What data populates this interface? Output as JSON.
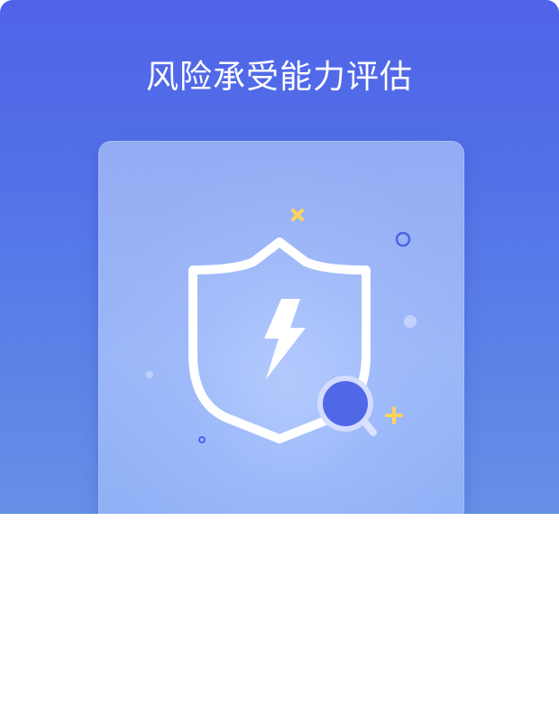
{
  "header": {
    "title": "风险承受能力评估"
  },
  "illustration": {
    "shield_icon": "shield-icon",
    "lightning_icon": "lightning-bolt-icon",
    "magnifier_icon": "magnifier-icon",
    "accent_color": "#5168e6",
    "decoration_yellow": "#ffd45a",
    "decoration_blue": "#4d63e8"
  },
  "background": {
    "top": "#4f63e8",
    "bottom": "#6690e6",
    "page": "#ffffff"
  }
}
